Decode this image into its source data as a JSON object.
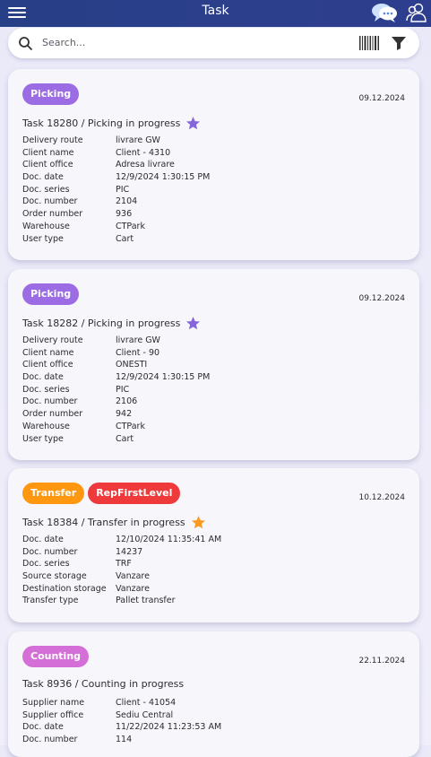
{
  "header": {
    "title": "Task"
  },
  "search": {
    "placeholder": "Search..."
  },
  "colors": {
    "picking": "#9b6ce3",
    "transfer": "#ff9711",
    "rep": "#ee3a3a",
    "counting": "#d46fd8",
    "star_purple": "#8466d8",
    "star_orange": "#f89920"
  },
  "cards": [
    {
      "badges": [
        {
          "label": "Picking",
          "color": "#9b6ce3"
        }
      ],
      "date": "09.12.2024",
      "title": "Task 18280 / Picking in progress",
      "star_color": "#8466d8",
      "fields": [
        {
          "k": "Delivery route",
          "v": "livrare GW"
        },
        {
          "k": "Client name",
          "v": "Client - 4310"
        },
        {
          "k": "Client office",
          "v": "Adresa livrare"
        },
        {
          "k": "Doc. date",
          "v": "12/9/2024 1:30:15 PM"
        },
        {
          "k": "Doc. series",
          "v": "PIC"
        },
        {
          "k": "Doc. number",
          "v": "2104"
        },
        {
          "k": "Order number",
          "v": "936"
        },
        {
          "k": "Warehouse",
          "v": "CTPark"
        },
        {
          "k": "User type",
          "v": "Cart"
        }
      ]
    },
    {
      "badges": [
        {
          "label": "Picking",
          "color": "#9b6ce3"
        }
      ],
      "date": "09.12.2024",
      "title": "Task 18282 / Picking in progress",
      "star_color": "#8466d8",
      "fields": [
        {
          "k": "Delivery route",
          "v": "livrare GW"
        },
        {
          "k": "Client name",
          "v": "Client - 90"
        },
        {
          "k": "Client office",
          "v": "ONESTI"
        },
        {
          "k": "Doc. date",
          "v": "12/9/2024 1:30:15 PM"
        },
        {
          "k": "Doc. series",
          "v": "PIC"
        },
        {
          "k": "Doc. number",
          "v": "2106"
        },
        {
          "k": "Order number",
          "v": "942"
        },
        {
          "k": "Warehouse",
          "v": "CTPark"
        },
        {
          "k": "User type",
          "v": "Cart"
        }
      ]
    },
    {
      "badges": [
        {
          "label": "Transfer",
          "color": "#ff9711"
        },
        {
          "label": "RepFirstLevel",
          "color": "#ee3a3a"
        }
      ],
      "date": "10.12.2024",
      "title": "Task 18384 / Transfer in progress",
      "star_color": "#f89920",
      "fields": [
        {
          "k": "Doc. date",
          "v": "12/10/2024 11:35:41 AM"
        },
        {
          "k": "Doc. number",
          "v": "14237"
        },
        {
          "k": "Doc. series",
          "v": "TRF"
        },
        {
          "k": "Source storage",
          "v": "Vanzare"
        },
        {
          "k": "Destination storage",
          "v": "Vanzare"
        },
        {
          "k": "Transfer type",
          "v": "Pallet transfer"
        }
      ]
    },
    {
      "badges": [
        {
          "label": "Counting",
          "color": "#d46fd8"
        }
      ],
      "date": "22.11.2024",
      "title": "Task 8936 / Counting in progress",
      "star_color": "",
      "fields": [
        {
          "k": "Supplier name",
          "v": "Client - 41054"
        },
        {
          "k": "Supplier office",
          "v": "Sediu Central"
        },
        {
          "k": "Doc. date",
          "v": "11/22/2024 11:23:53 AM"
        },
        {
          "k": "Doc. number",
          "v": "114"
        }
      ]
    }
  ]
}
